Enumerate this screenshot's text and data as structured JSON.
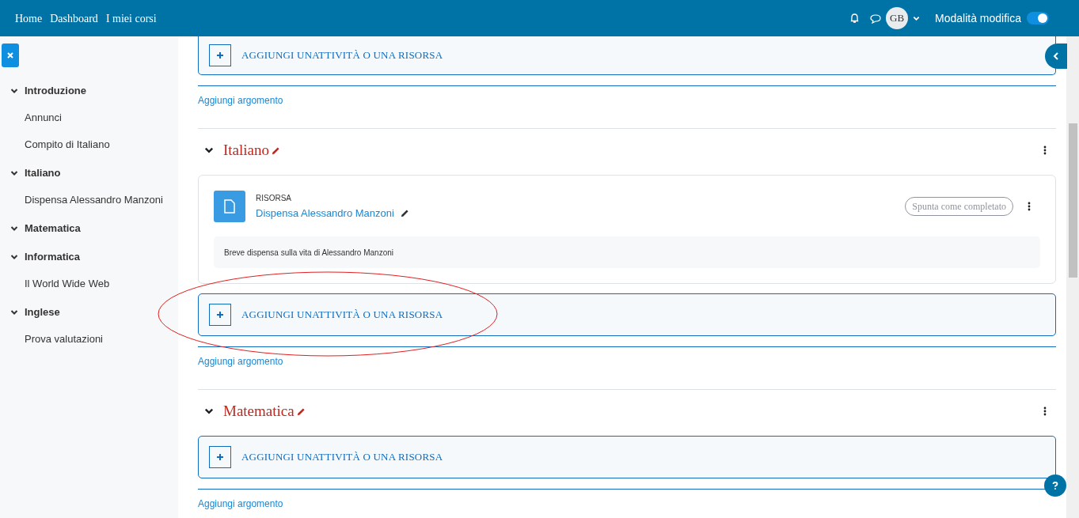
{
  "navbar": {
    "links": [
      "Home",
      "Dashboard",
      "I miei corsi"
    ],
    "user_initials": "GB",
    "edit_mode_label": "Modalità modifica",
    "edit_mode_on": true
  },
  "sidebar": {
    "sections": [
      {
        "title": "Introduzione",
        "expanded": true,
        "children": [
          {
            "label": "Annunci"
          },
          {
            "label": "Compito di Italiano"
          }
        ]
      },
      {
        "title": "Italiano",
        "expanded": true,
        "children": [
          {
            "label": "Dispensa Alessandro Manzoni"
          }
        ]
      },
      {
        "title": "Matematica",
        "expanded": true
      },
      {
        "title": "Informatica",
        "expanded": true,
        "children": [
          {
            "label": "Il World Wide Web"
          }
        ]
      },
      {
        "title": "Inglese",
        "expanded": true,
        "children": [
          {
            "label": "Prova valutazioni"
          }
        ]
      }
    ]
  },
  "sections": [
    {
      "add_activity": "AGGIUNGI UNATTIVITÀ O UNA RISORSA",
      "add_topic": "Aggiungi argomento"
    },
    {
      "title": "Italiano",
      "expanded": true,
      "add_activity": "AGGIUNGI UNATTIVITÀ O UNA RISORSA",
      "add_topic": "Aggiungi argomento",
      "highlighted": true,
      "activities": [
        {
          "type": "RISORSA",
          "name": "Dispensa Alessandro Manzoni",
          "completion": "Spunta come completato",
          "description": "Breve dispensa sulla vita di Alessandro Manzoni"
        }
      ]
    },
    {
      "title": "Matematica",
      "expanded": true,
      "add_activity": "AGGIUNGI UNATTIVITÀ O UNA RISORSA",
      "add_topic": "Aggiungi argomento"
    }
  ]
}
